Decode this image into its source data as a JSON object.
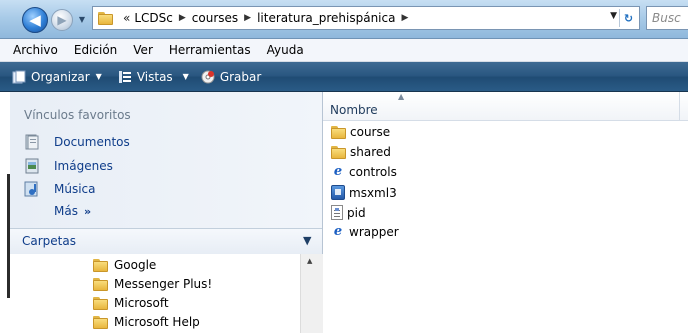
{
  "address_bar": {
    "overflow_chevron": "«",
    "breadcrumbs": [
      "LCDSc",
      "courses",
      "literatura_prehispánica"
    ],
    "search_placeholder": "Busc"
  },
  "menu": {
    "items": [
      "Archivo",
      "Edición",
      "Ver",
      "Herramientas",
      "Ayuda"
    ]
  },
  "toolbar": {
    "organize": "Organizar",
    "views": "Vistas",
    "burn": "Grabar"
  },
  "favorites": {
    "header": "Vínculos favoritos",
    "items": [
      {
        "label": "Documentos",
        "icon": "documents-icon"
      },
      {
        "label": "Imágenes",
        "icon": "pictures-icon"
      },
      {
        "label": "Música",
        "icon": "music-icon"
      }
    ],
    "more_label": "Más",
    "more_glyph": "»"
  },
  "folders": {
    "header": "Carpetas",
    "items": [
      "Google",
      "Messenger Plus!",
      "Microsoft",
      "Microsoft Help"
    ]
  },
  "file_list": {
    "column_name": "Nombre",
    "files": [
      {
        "name": "course",
        "icon": "folder-icon"
      },
      {
        "name": "shared",
        "icon": "folder-icon"
      },
      {
        "name": "controls",
        "icon": "ie-html-icon"
      },
      {
        "name": "msxml3",
        "icon": "installer-icon"
      },
      {
        "name": "pid",
        "icon": "text-file-icon"
      },
      {
        "name": "wrapper",
        "icon": "ie-html-icon"
      }
    ]
  },
  "colors": {
    "link_blue": "#0f3d8a",
    "command_bar": "#28557f",
    "address_bar": "#a9cbe8"
  }
}
